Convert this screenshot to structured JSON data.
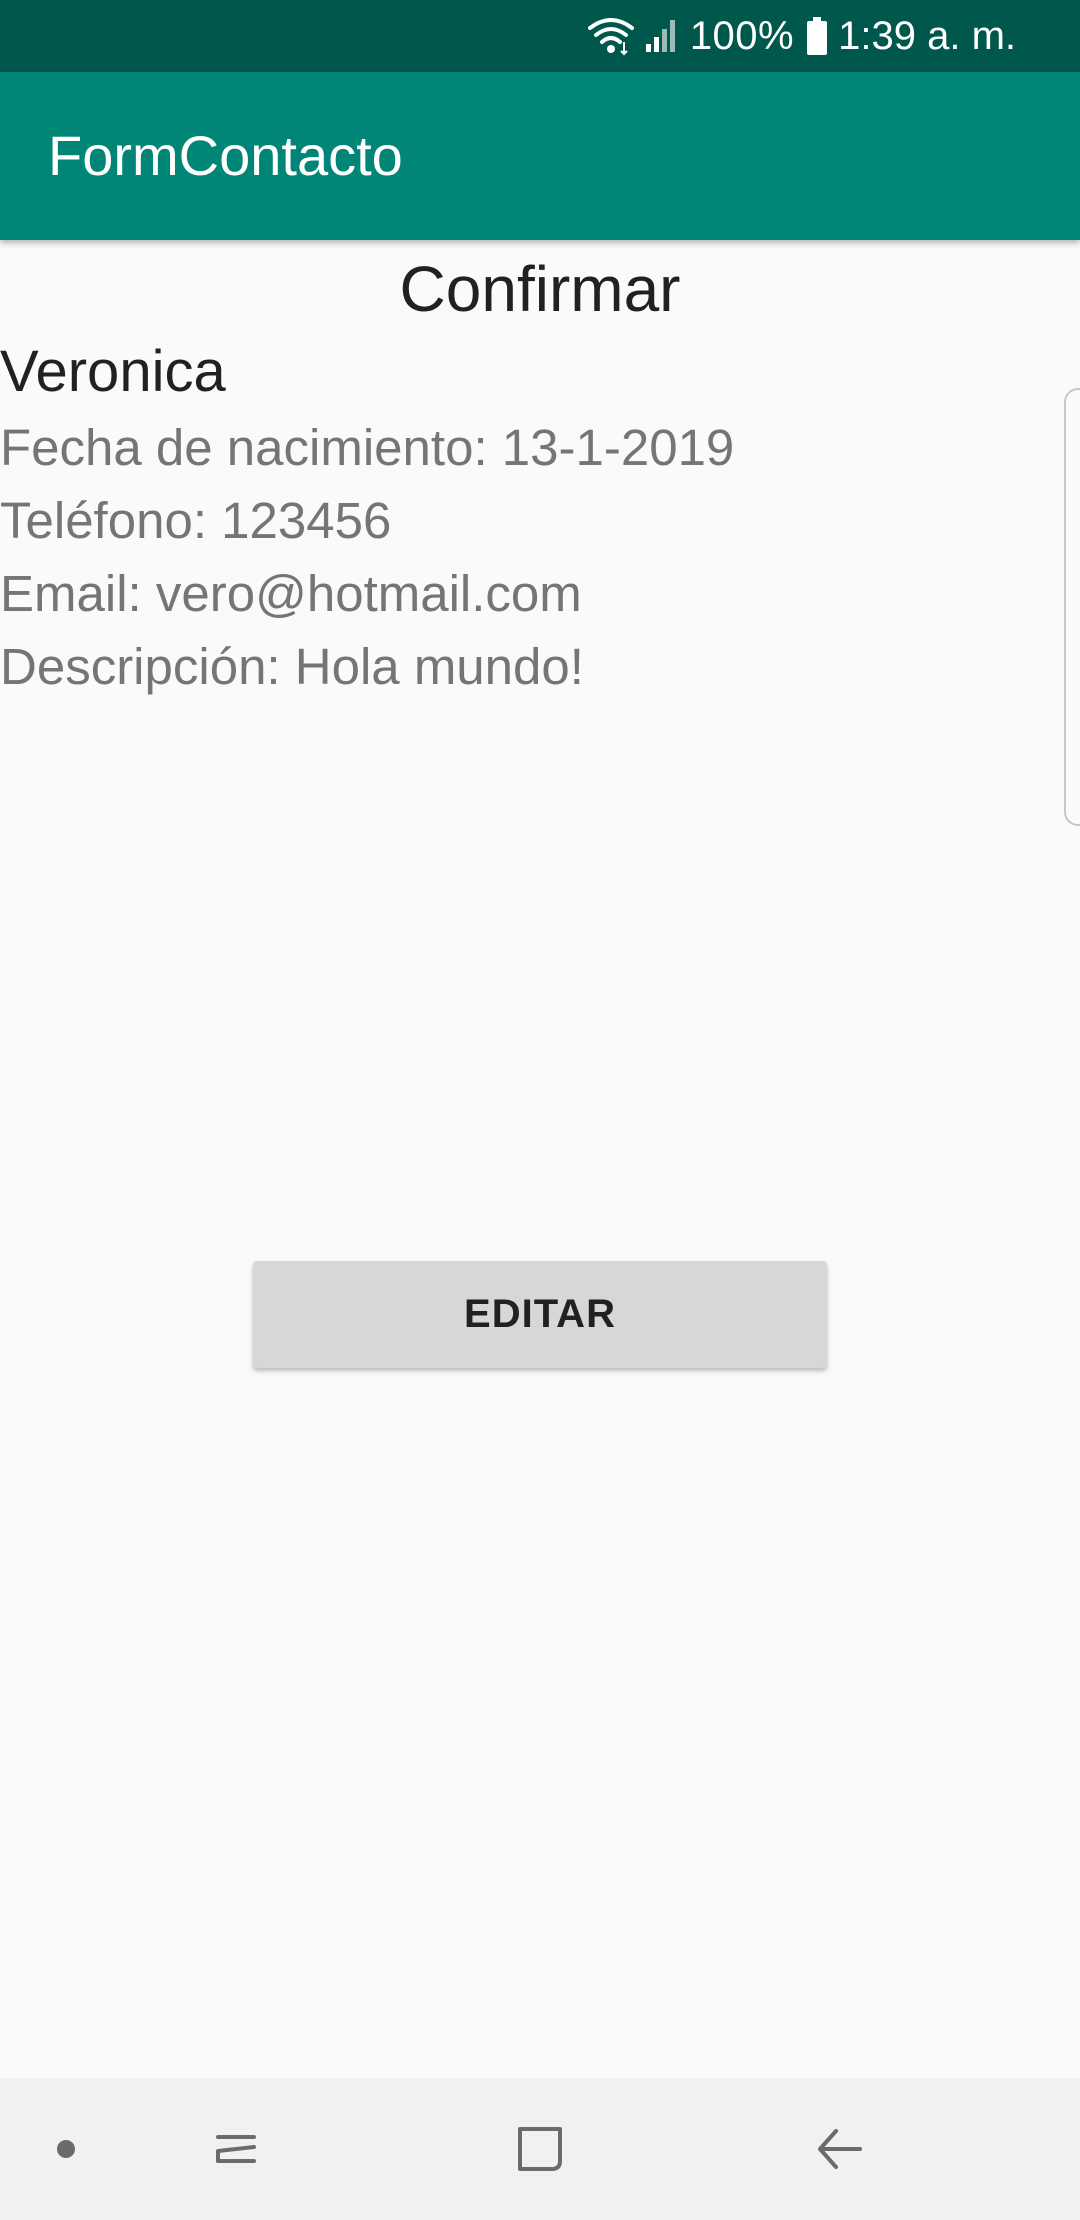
{
  "status_bar": {
    "battery_percent": "100%",
    "time": "1:39 a. m.",
    "icons": [
      "wifi-icon",
      "signal-icon",
      "battery-icon"
    ]
  },
  "app_bar": {
    "title": "FormContacto",
    "color": "#008577"
  },
  "confirm": {
    "heading": "Confirmar",
    "name": "Veronica",
    "details": [
      "Fecha de nacimiento: 13-1-2019",
      "Teléfono: 123456",
      "Email: vero@hotmail.com",
      "Descripción: Hola mundo!"
    ]
  },
  "actions": {
    "edit_label": "EDITAR"
  },
  "nav_bar": {
    "icons": [
      "home-dot-icon",
      "recent-apps-icon",
      "overview-icon",
      "back-icon"
    ]
  },
  "colors": {
    "status_bar": "#00574b",
    "accent": "#008577",
    "background": "#fafafa"
  }
}
